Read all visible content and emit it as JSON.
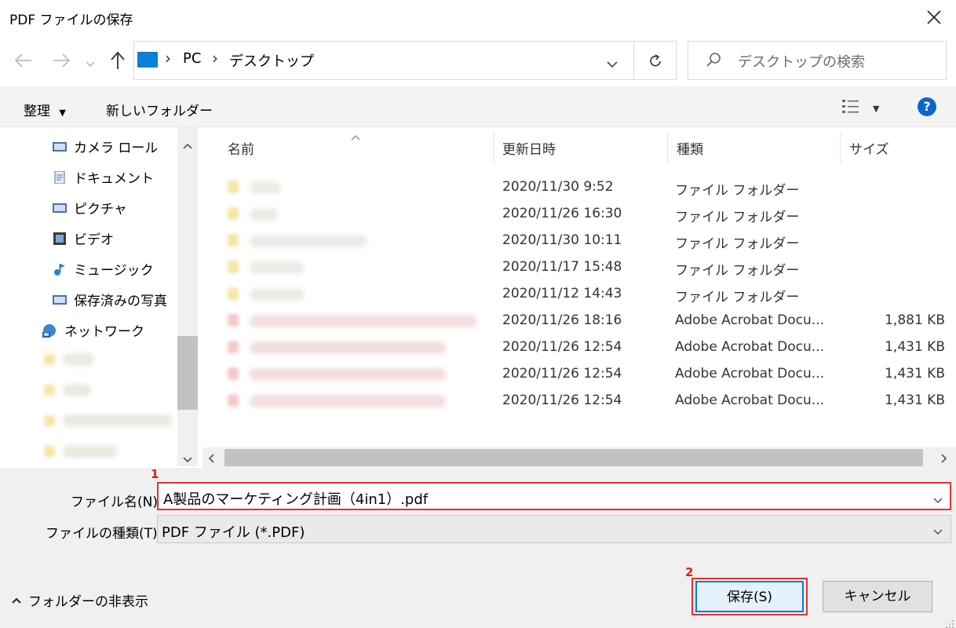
{
  "window": {
    "title": "PDF ファイルの保存"
  },
  "address": {
    "crumbs": [
      "PC",
      "デスクトップ"
    ],
    "search_placeholder": "デスクトップの検索"
  },
  "toolbar": {
    "organize": "整理",
    "new_folder": "新しいフォルダー",
    "help": "?"
  },
  "nav": {
    "items": [
      {
        "label": "カメラ ロール",
        "icon": "camera-roll-icon"
      },
      {
        "label": "ドキュメント",
        "icon": "documents-icon"
      },
      {
        "label": "ピクチャ",
        "icon": "pictures-icon"
      },
      {
        "label": "ビデオ",
        "icon": "videos-icon"
      },
      {
        "label": "ミュージック",
        "icon": "music-icon"
      },
      {
        "label": "保存済みの写真",
        "icon": "saved-pictures-icon"
      },
      {
        "label": "ネットワーク",
        "icon": "network-icon"
      }
    ]
  },
  "columns": {
    "name": "名前",
    "date": "更新日時",
    "type": "種類",
    "size": "サイズ"
  },
  "files": [
    {
      "date": "2020/11/30 9:52",
      "type": "ファイル フォルダー",
      "size": "",
      "kind": "folder"
    },
    {
      "date": "2020/11/26 16:30",
      "type": "ファイル フォルダー",
      "size": "",
      "kind": "folder"
    },
    {
      "date": "2020/11/30 10:11",
      "type": "ファイル フォルダー",
      "size": "",
      "kind": "folder"
    },
    {
      "date": "2020/11/17 15:48",
      "type": "ファイル フォルダー",
      "size": "",
      "kind": "folder"
    },
    {
      "date": "2020/11/12 14:43",
      "type": "ファイル フォルダー",
      "size": "",
      "kind": "folder"
    },
    {
      "date": "2020/11/26 18:16",
      "type": "Adobe Acrobat Docu...",
      "size": "1,881 KB",
      "kind": "pdf"
    },
    {
      "date": "2020/11/26 12:54",
      "type": "Adobe Acrobat Docu...",
      "size": "1,431 KB",
      "kind": "pdf"
    },
    {
      "date": "2020/11/26 12:54",
      "type": "Adobe Acrobat Docu...",
      "size": "1,431 KB",
      "kind": "pdf"
    },
    {
      "date": "2020/11/26 12:54",
      "type": "Adobe Acrobat Docu...",
      "size": "1,431 KB",
      "kind": "pdf"
    }
  ],
  "form": {
    "filename_label": "ファイル名(N):",
    "filename_value": "A製品のマーケティング計画（4in1）.pdf",
    "filetype_label": "ファイルの種類(T):",
    "filetype_value": "PDF ファイル (*.PDF)"
  },
  "footer": {
    "hide_folders": "フォルダーの非表示",
    "save": "保存(S)",
    "cancel": "キャンセル"
  },
  "annotations": {
    "one": "1",
    "two": "2"
  },
  "colors": {
    "accent": "#0a78d7",
    "annotation": "#e0303a"
  }
}
